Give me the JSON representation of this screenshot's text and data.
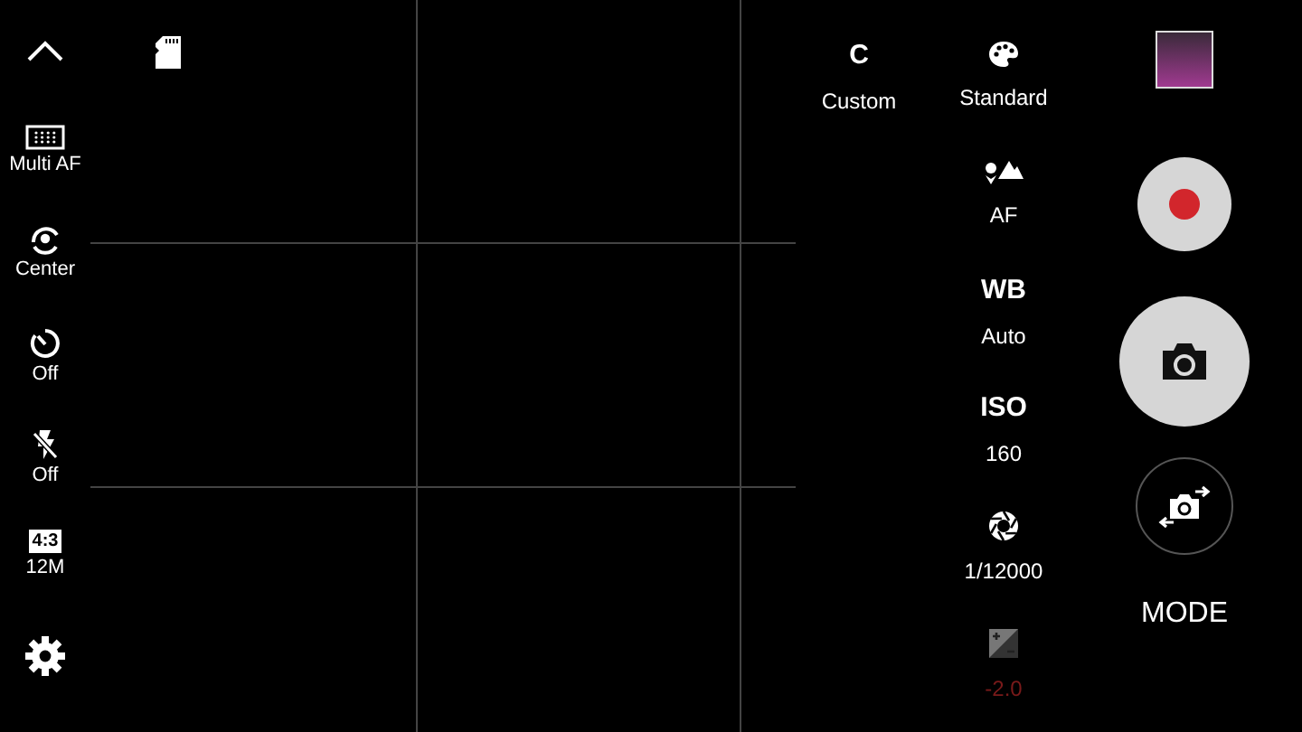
{
  "left_bar": [
    {
      "kind": "collapse"
    },
    {
      "kind": "af-area",
      "label": "Multi AF"
    },
    {
      "kind": "metering",
      "label": "Center"
    },
    {
      "kind": "timer",
      "label": "Off"
    },
    {
      "kind": "flash",
      "label": "Off"
    },
    {
      "kind": "ratio",
      "badge": "4:3",
      "label": "12M"
    },
    {
      "kind": "settings"
    }
  ],
  "top_settings": [
    {
      "kind": "text",
      "title": "C",
      "value": "Custom"
    },
    {
      "kind": "palette",
      "value": "Standard"
    }
  ],
  "settings": [
    {
      "kind": "flower",
      "value": "AF",
      "disabled": false
    },
    {
      "kind": "text",
      "title": "WB",
      "value": "Auto",
      "disabled": false
    },
    {
      "kind": "text",
      "title": "ISO",
      "value": "160",
      "disabled": false
    },
    {
      "kind": "shutter",
      "value": "1/12000",
      "disabled": false
    },
    {
      "kind": "exposure",
      "value": "-2.0",
      "disabled": true
    }
  ],
  "mode_button": "MODE"
}
